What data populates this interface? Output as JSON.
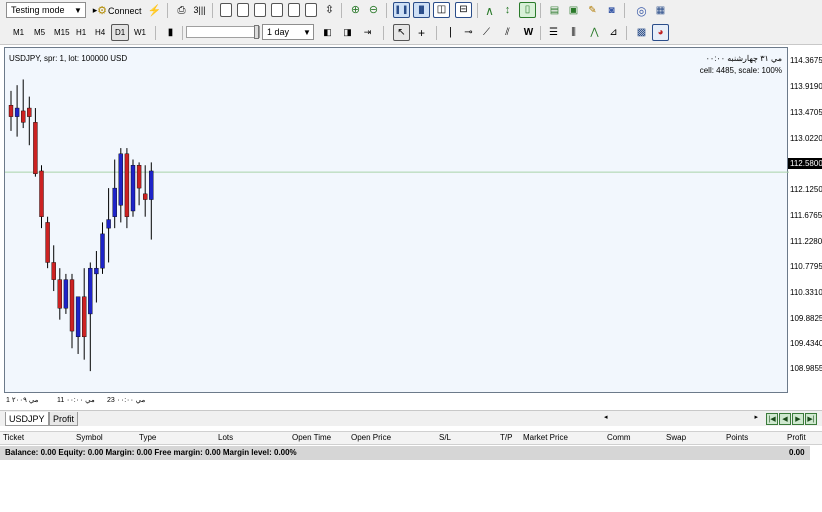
{
  "toolbar": {
    "mode_select": "Testing mode",
    "connect_label": "Connect",
    "timeframes": [
      "M1",
      "M5",
      "M15",
      "H1",
      "H4",
      "D1",
      "W1"
    ],
    "selected_timeframe": "D1",
    "period_select": "1 day"
  },
  "chart": {
    "symbol_info": "USDJPY, spr: 1, lot: 100000 USD",
    "date_info": "مي ٣١ چهارشنبه ٠٠:٠٠",
    "cell_info": "cell: 4485, scale: 100%",
    "price_labels": [
      "114.3675",
      "113.9190",
      "113.4705",
      "113.0220",
      "112.5800",
      "112.1250",
      "111.6765",
      "111.2280",
      "110.7795",
      "110.3310",
      "109.8825",
      "109.4340",
      "108.9855"
    ],
    "current_price": "112.5800",
    "x_labels": [
      "مي ٢٠٠٩ 1",
      "مي ٠٠:٠٠ 11",
      "مي ٠٠:٠٠ 23"
    ]
  },
  "chart_data": {
    "type": "candlestick",
    "title": "USDJPY, spr: 1, lot: 100000 USD",
    "ylim": [
      108.7,
      114.75
    ],
    "current_price": 112.58,
    "colors": {
      "bull": "#1e24c8",
      "bear": "#cc2222"
    },
    "candles": [
      {
        "o": 113.75,
        "h": 114.0,
        "l": 113.3,
        "c": 113.55
      },
      {
        "o": 113.55,
        "h": 114.1,
        "l": 113.2,
        "c": 113.7
      },
      {
        "o": 113.65,
        "h": 114.2,
        "l": 113.35,
        "c": 113.45
      },
      {
        "o": 113.7,
        "h": 113.9,
        "l": 113.05,
        "c": 113.55
      },
      {
        "o": 113.45,
        "h": 113.7,
        "l": 112.5,
        "c": 112.55
      },
      {
        "o": 112.6,
        "h": 112.7,
        "l": 111.6,
        "c": 111.8
      },
      {
        "o": 111.7,
        "h": 111.8,
        "l": 110.9,
        "c": 111.0
      },
      {
        "o": 111.0,
        "h": 111.3,
        "l": 110.5,
        "c": 110.7
      },
      {
        "o": 110.7,
        "h": 110.9,
        "l": 110.0,
        "c": 110.2
      },
      {
        "o": 110.2,
        "h": 110.8,
        "l": 110.1,
        "c": 110.7
      },
      {
        "o": 110.7,
        "h": 110.8,
        "l": 109.5,
        "c": 109.8
      },
      {
        "o": 109.7,
        "h": 110.4,
        "l": 109.4,
        "c": 110.4
      },
      {
        "o": 110.4,
        "h": 110.9,
        "l": 109.3,
        "c": 109.7
      },
      {
        "o": 110.1,
        "h": 111.0,
        "l": 109.1,
        "c": 110.9
      },
      {
        "o": 110.8,
        "h": 111.2,
        "l": 110.3,
        "c": 110.9
      },
      {
        "o": 110.9,
        "h": 111.7,
        "l": 110.8,
        "c": 111.5
      },
      {
        "o": 111.6,
        "h": 112.3,
        "l": 111.0,
        "c": 111.75
      },
      {
        "o": 111.8,
        "h": 112.8,
        "l": 111.6,
        "c": 112.3
      },
      {
        "o": 112.0,
        "h": 113.0,
        "l": 111.7,
        "c": 112.9
      },
      {
        "o": 112.9,
        "h": 113.0,
        "l": 111.6,
        "c": 111.8
      },
      {
        "o": 111.9,
        "h": 112.8,
        "l": 111.8,
        "c": 112.7
      },
      {
        "o": 112.7,
        "h": 112.75,
        "l": 112.0,
        "c": 112.3
      },
      {
        "o": 112.2,
        "h": 112.7,
        "l": 111.8,
        "c": 112.1
      },
      {
        "o": 112.1,
        "h": 112.75,
        "l": 111.4,
        "c": 112.6
      }
    ]
  },
  "tabs": {
    "items": [
      "USDJPY",
      "Profit"
    ],
    "active": "USDJPY"
  },
  "table": {
    "headers": [
      "Ticket",
      "Symbol",
      "Type",
      "Lots",
      "Open Time",
      "Open Price",
      "S/L",
      "T/P",
      "Market Price",
      "Comm",
      "Swap",
      "Points",
      "Profit"
    ],
    "balance_text": "Balance: 0.00 Equity: 0.00 Margin: 0.00 Free margin: 0.00 Margin level: 0.00%",
    "balance_profit": "0.00"
  }
}
